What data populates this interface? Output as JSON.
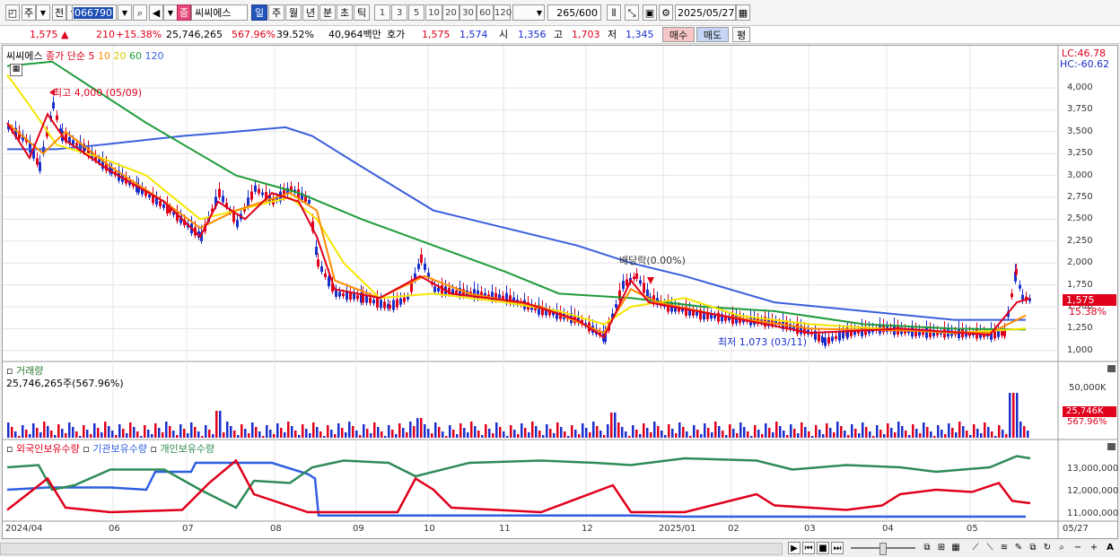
{
  "toolbar": {
    "market_label": "주",
    "prev_label": "전",
    "code": "066790",
    "stock_name_badge": "종",
    "stock_name": "씨씨에스",
    "period_buttons": [
      "일",
      "주",
      "월",
      "년",
      "분",
      "초",
      "틱"
    ],
    "interval_buttons": [
      "1",
      "3",
      "5",
      "10",
      "20",
      "30",
      "60",
      "120"
    ],
    "count_value": "265",
    "count_total": "/600",
    "date": "2025/05/27"
  },
  "quote": {
    "price": "1,575",
    "arrow": "▲",
    "change": "210",
    "change_pct": "+15.38%",
    "volume": "25,746,265",
    "volume_ratio": "567.96%",
    "turnover": "39.52%",
    "amount": "40,964백만",
    "bid_label": "호가",
    "ask_price": "1,575",
    "bid_price": "1,574",
    "open_label": "시",
    "open": "1,356",
    "high_label": "고",
    "high": "1,703",
    "low_label": "저",
    "low": "1,345",
    "buy_button": "매수",
    "sell_button": "매도",
    "eval_button": "평"
  },
  "price_pane": {
    "stock_label": "씨씨에스",
    "ma_label": "종가 단순",
    "ma_periods": [
      "5",
      "10",
      "20",
      "60",
      "120"
    ],
    "lc": "LC:46.78",
    "hc": "HC:-60.62",
    "high_annotation": "최고 4,000 (05/09)",
    "low_annotation": "최저 1,073 (03/11)",
    "dividend_annotation": "배당락(0.00%)",
    "current_price_tag": "1,575",
    "current_change_tag": "15.38%",
    "y_ticks": [
      "4,000",
      "3,750",
      "3,500",
      "3,250",
      "3,000",
      "2,750",
      "2,500",
      "2,250",
      "2,000",
      "1,750",
      "1,500",
      "1,250",
      "1,000"
    ]
  },
  "volume_pane": {
    "title": "거래량",
    "value_label": "25,746,265주(567.96%)",
    "y_tick": "50,000K",
    "current_tag": "25,746K",
    "current_pct": "567.96%"
  },
  "holding_pane": {
    "legend_foreign": "외국인보유수량",
    "legend_inst": "기관보유수량",
    "legend_indiv": "개인보유수량",
    "y_ticks": [
      "13,000,000",
      "12,000,000",
      "11,000,000"
    ]
  },
  "x_axis": [
    "2024/04",
    "06",
    "07",
    "08",
    "09",
    "10",
    "11",
    "12",
    "2025/01",
    "02",
    "03",
    "04",
    "05",
    "05/27"
  ],
  "colors": {
    "up": "#e0001b",
    "down": "#1a2fcc",
    "ma5": "#e0001b",
    "ma10": "#ff8c00",
    "ma20": "#f5e600",
    "ma60": "#1e9b3a",
    "ma120": "#3b5fdc",
    "foreign": "#e0001b",
    "inst": "#2f5fe0",
    "indiv": "#2e8b57"
  }
}
